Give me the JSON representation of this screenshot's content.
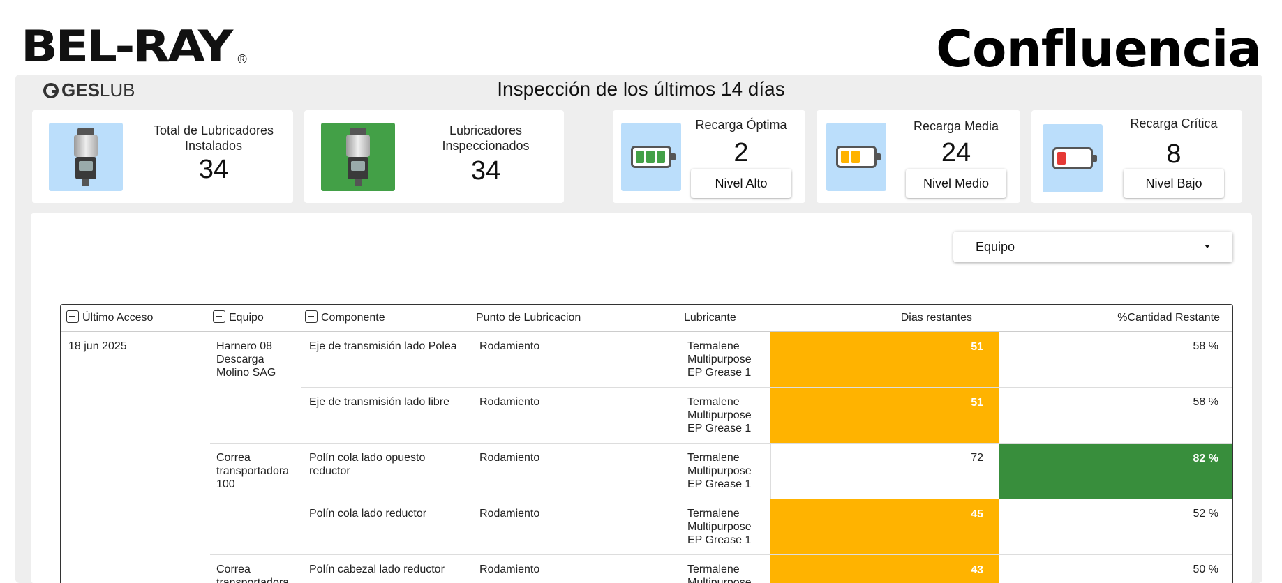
{
  "header": {
    "brand_logo": "BEL-RAY",
    "brand_reg": "®",
    "client_name": "Confluencia",
    "geslub_g": "GES",
    "geslub_rest": "LUB",
    "page_title": "Inspección de los últimos 14 días"
  },
  "kpis": {
    "total": {
      "title_line1": "Total de Lubricadores",
      "title_line2": "Instalados",
      "value": "34",
      "icon": "lubricator-icon",
      "icon_bg": "#bbdefb"
    },
    "inspected": {
      "title_line1": "Lubricadores",
      "title_line2": "Inspeccionados",
      "value": "34",
      "icon": "lubricator-icon",
      "icon_bg": "#43a047"
    },
    "optimal": {
      "title": "Recarga Óptima",
      "value": "2",
      "level": "Nivel Alto",
      "icon": "battery-full-icon",
      "icon_bg": "#bbdefb",
      "color": "#43a047"
    },
    "medium": {
      "title": "Recarga Media",
      "value": "24",
      "level": "Nivel Medio",
      "icon": "battery-half-icon",
      "icon_bg": "#bbdefb",
      "color": "#ffb300"
    },
    "critical": {
      "title": "Recarga Crítica",
      "value": "8",
      "level": "Nivel Bajo",
      "icon": "battery-low-icon",
      "icon_bg": "#bbdefb",
      "color": "#e53935"
    }
  },
  "filter": {
    "label": "Equipo"
  },
  "table": {
    "columns": [
      "Último Acceso",
      "Equipo",
      "Componente",
      "Punto de Lubricacion",
      "Lubricante",
      "Dias restantes",
      "%Cantidad Restante"
    ],
    "rows": [
      {
        "fecha": "18 jun 2025",
        "equipo": "Harnero 08 Descarga Molino SAG",
        "componente": "Eje de transmisión lado Polea",
        "punto": "Rodamiento",
        "lubricante": "Termalene Multipurpose EP Grease 1",
        "dias": "51",
        "cantidad": "58 %"
      },
      {
        "fecha": "",
        "equipo": "",
        "componente": "Eje de transmisión lado libre",
        "punto": "Rodamiento",
        "lubricante": "Termalene Multipurpose EP Grease 1",
        "dias": "51",
        "cantidad": "58 %"
      },
      {
        "fecha": "",
        "equipo": "Correa transportadora 100",
        "componente": "Polín cola lado opuesto reductor",
        "punto": "Rodamiento",
        "lubricante": "Termalene Multipurpose EP Grease 1",
        "dias": "72",
        "cantidad": "82 %"
      },
      {
        "fecha": "",
        "equipo": "",
        "componente": "Polín cola lado reductor",
        "punto": "Rodamiento",
        "lubricante": "Termalene Multipurpose EP Grease 1",
        "dias": "45",
        "cantidad": "52 %"
      },
      {
        "fecha": "",
        "equipo": "Correa transportadora",
        "componente": "Polín cabezal lado reductor",
        "punto": "Rodamiento",
        "lubricante": "Termalene Multipurpose",
        "dias": "43",
        "cantidad": "50 %"
      }
    ]
  }
}
